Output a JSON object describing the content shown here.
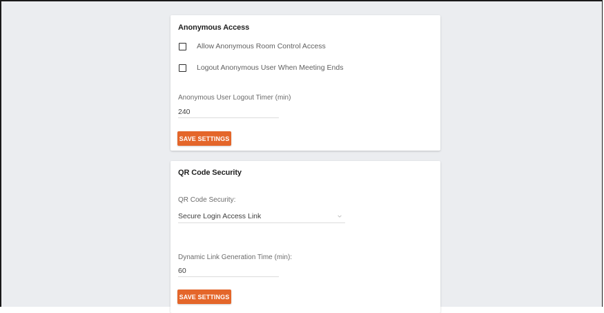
{
  "anonymous_access": {
    "title": "Anonymous Access",
    "checkboxes": [
      {
        "label": "Allow Anonymous Room Control Access",
        "checked": false
      },
      {
        "label": "Logout Anonymous User When Meeting Ends",
        "checked": false
      }
    ],
    "logout_timer": {
      "label": "Anonymous User Logout Timer (min)",
      "value": "240"
    },
    "save_label": "SAVE SETTINGS"
  },
  "qr_code_security": {
    "title": "QR Code Security",
    "security_select": {
      "label": "QR Code Security:",
      "selected": "Secure Login Access Link",
      "icon": "chevron-down-icon"
    },
    "link_generation_time": {
      "label": "Dynamic Link Generation Time (min):",
      "value": "60"
    },
    "save_label": "SAVE SETTINGS"
  },
  "colors": {
    "page_background": "#ebedf0",
    "card_background": "#ffffff",
    "accent_button": "#e4662a",
    "title_text": "#1f1f1f",
    "label_text": "#6b6b6b"
  }
}
